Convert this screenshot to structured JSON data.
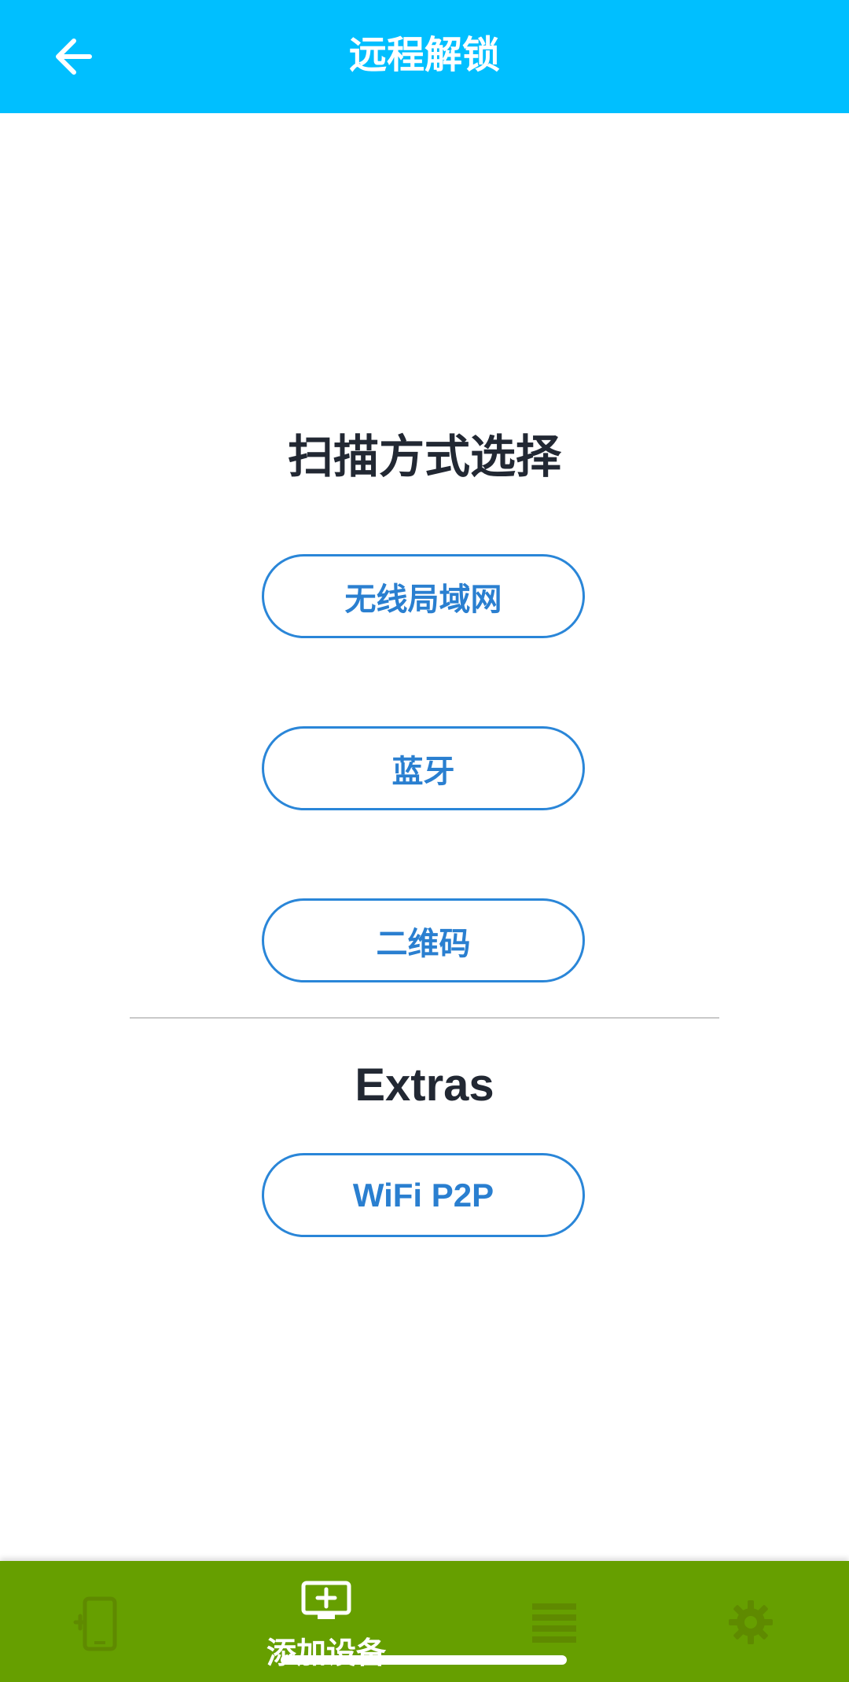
{
  "header": {
    "title": "远程解锁",
    "back_icon": "arrow-left-icon"
  },
  "scan": {
    "title": "扫描方式选择",
    "options": [
      {
        "label": "无线局域网"
      },
      {
        "label": "蓝牙"
      },
      {
        "label": "二维码"
      }
    ]
  },
  "extras": {
    "title": "Extras",
    "options": [
      {
        "label": "WiFi P2P"
      }
    ]
  },
  "bottom_nav": {
    "items": [
      {
        "icon": "device-phone-icon",
        "label": "",
        "active": false
      },
      {
        "icon": "add-device-icon",
        "label": "添加设备",
        "active": true
      },
      {
        "icon": "list-icon",
        "label": "",
        "active": false
      },
      {
        "icon": "gear-icon",
        "label": "",
        "active": false
      }
    ]
  },
  "colors": {
    "header_bg": "#00bfff",
    "accent_blue": "#2a86d8",
    "bottom_bar_bg": "#669f00",
    "inactive_icon": "#5f8a00"
  }
}
